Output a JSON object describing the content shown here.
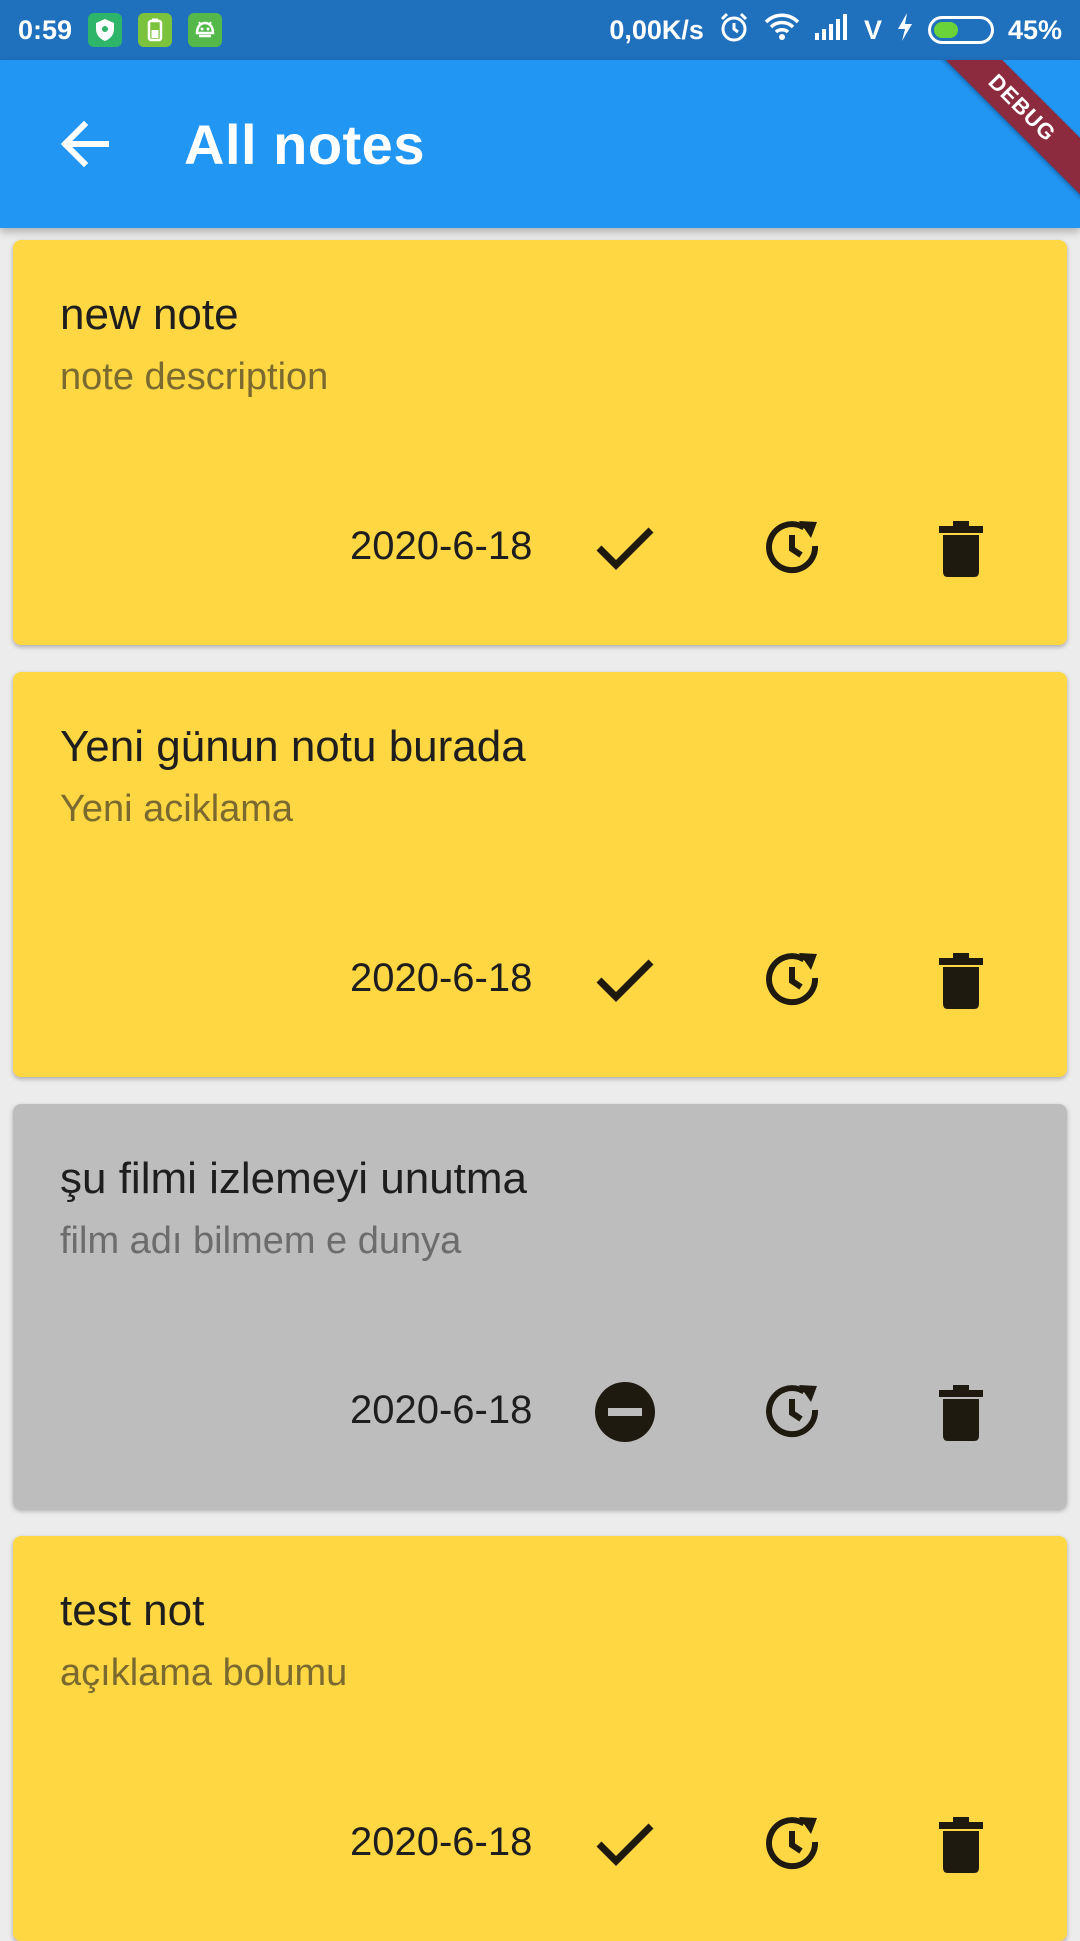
{
  "status_bar": {
    "time": "0:59",
    "network_speed": "0,00K/s",
    "carrier": "V",
    "battery": "45%",
    "battery_level": 0.45
  },
  "app_bar": {
    "title": "All notes",
    "debug_label": "DEBUG",
    "color": "#2196f3"
  },
  "colors": {
    "active_card": "#fed743",
    "done_card": "#bdbdbd",
    "icon": "#1e1a10"
  },
  "notes": [
    {
      "title": "new note",
      "description": "note description",
      "date": "2020-6-18",
      "status_icon": "check-icon",
      "card_state": "active"
    },
    {
      "title": "Yeni günun notu burada",
      "description": "Yeni aciklama",
      "date": "2020-6-18",
      "status_icon": "check-icon",
      "card_state": "active"
    },
    {
      "title": "şu filmi izlemeyi unutma",
      "description": "film adı bilmem e dunya",
      "date": "2020-6-18",
      "status_icon": "remove-circle-icon",
      "card_state": "done"
    },
    {
      "title": "test not",
      "description": "açıklama bolumu",
      "date": "2020-6-18",
      "status_icon": "check-icon",
      "card_state": "active"
    }
  ]
}
